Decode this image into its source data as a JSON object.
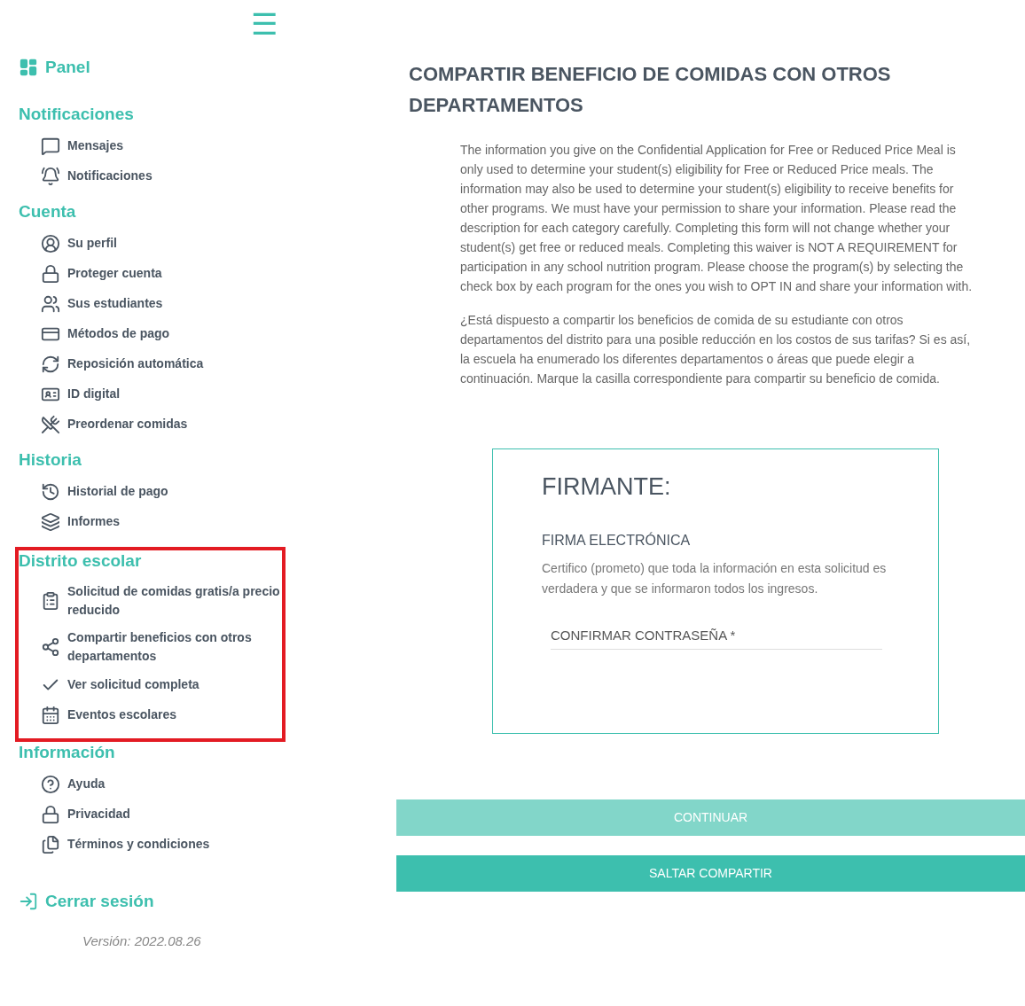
{
  "menu_button": {
    "label": "☰"
  },
  "sidebar": {
    "dashboard": "Panel",
    "sections": [
      {
        "title": "Notificaciones",
        "highlighted": false,
        "items": [
          {
            "label": "Mensajes"
          },
          {
            "label": "Notificaciones"
          }
        ]
      },
      {
        "title": "Cuenta",
        "highlighted": false,
        "items": [
          {
            "label": "Su perfil"
          },
          {
            "label": "Proteger cuenta"
          },
          {
            "label": "Sus estudiantes"
          },
          {
            "label": "Métodos de pago"
          },
          {
            "label": "Reposición automática"
          },
          {
            "label": "ID digital"
          },
          {
            "label": "Preordenar comidas"
          }
        ]
      },
      {
        "title": "Historia",
        "highlighted": false,
        "items": [
          {
            "label": "Historial de pago"
          },
          {
            "label": "Informes"
          }
        ]
      },
      {
        "title": "Distrito escolar",
        "highlighted": true,
        "items": [
          {
            "label": "Solicitud de comidas gratis/a precio reducido"
          },
          {
            "label": "Compartir beneficios con otros departamentos"
          },
          {
            "label": "Ver solicitud completa"
          },
          {
            "label": "Eventos escolares"
          }
        ]
      },
      {
        "title": "Información",
        "highlighted": false,
        "items": [
          {
            "label": "Ayuda"
          },
          {
            "label": "Privacidad"
          },
          {
            "label": "Términos y condiciones"
          }
        ]
      }
    ],
    "logout": "Cerrar sesión",
    "version": "Versión: 2022.08.26"
  },
  "main": {
    "title": "COMPARTIR BENEFICIO DE COMIDAS CON OTROS DEPARTAMENTOS",
    "paragraphs": [
      "The information you give on the Confidential Application for Free or Reduced Price Meal is only used to determine your student(s) eligibility for Free or Reduced Price meals. The information may also be used to determine your student(s) eligibility to receive benefits for other programs. We must have your permission to share your information. Please read the description for each category carefully. Completing this form will not change whether your student(s) get free or reduced meals. Completing this waiver is NOT A REQUIREMENT for participation in any school nutrition program. Please choose the program(s) by selecting the check box by each program for the ones you wish to OPT IN and share your information with.",
      "¿Está dispuesto a compartir los beneficios de comida de su estudiante con otros departamentos del distrito para una posible reducción en los costos de sus tarifas? Si es así, la escuela ha enumerado los diferentes departamentos o áreas que puede elegir a continuación. Marque la casilla correspondiente para compartir su beneficio de comida."
    ],
    "signer": {
      "title": "FIRMANTE:",
      "subtitle": "FIRMA ELECTRÓNICA",
      "text": "Certifico (prometo) que toda la información en esta solicitud es verdadera y que se informaron todos los ingresos.",
      "password": {
        "placeholder": "CONFIRMAR CONTRASEÑA *"
      }
    },
    "buttons": [
      {
        "label": "CONTINUAR",
        "disabled": true
      },
      {
        "label": "SALTAR COMPARTIR",
        "disabled": false
      }
    ]
  }
}
